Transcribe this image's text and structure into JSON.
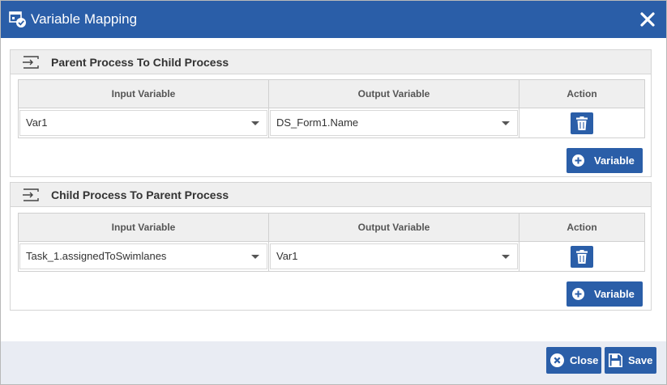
{
  "dialog": {
    "title": "Variable Mapping",
    "title_icon": "mapping-check-icon",
    "close_icon": "close-icon"
  },
  "colors": {
    "primary": "#2a5ea8",
    "header_bg": "#efefef",
    "footer_bg": "#e9ecf3"
  },
  "sections": [
    {
      "title": "Parent Process To Child Process",
      "icon": "input-arrow-icon",
      "columns": [
        "Input Variable",
        "Output Variable",
        "Action"
      ],
      "rows": [
        {
          "input": "Var1",
          "output": "DS_Form1.Name"
        }
      ],
      "add_label": "Variable"
    },
    {
      "title": "Child Process To Parent Process",
      "icon": "input-arrow-icon",
      "columns": [
        "Input Variable",
        "Output Variable",
        "Action"
      ],
      "rows": [
        {
          "input": "Task_1.assignedToSwimlanes",
          "output": "Var1"
        }
      ],
      "add_label": "Variable"
    }
  ],
  "footer": {
    "close_label": "Close",
    "save_label": "Save"
  }
}
